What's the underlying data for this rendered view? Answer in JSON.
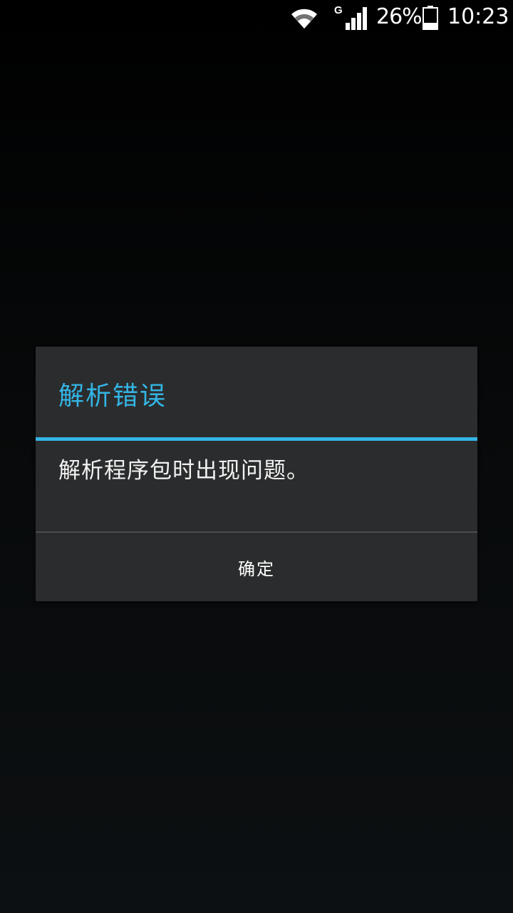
{
  "status_bar": {
    "network_type": "G",
    "battery_percent": "26%",
    "time": "10:23",
    "icons": [
      "wifi-icon",
      "signal-icon",
      "battery-icon"
    ]
  },
  "dialog": {
    "title": "解析错误",
    "message": "解析程序包时出现问题。",
    "ok_label": "确定"
  },
  "colors": {
    "accent": "#33b5e5",
    "dialog_background": "#2b2c2d",
    "screen_background": "#000000"
  }
}
